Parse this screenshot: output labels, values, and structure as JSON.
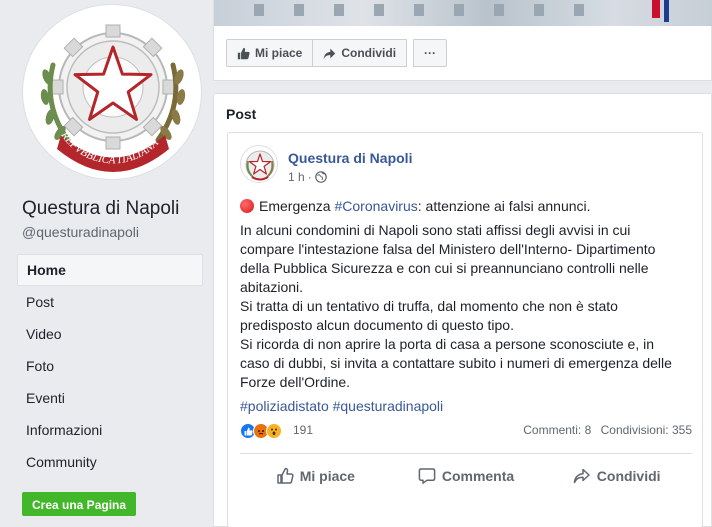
{
  "sidebar": {
    "page_name": "Questura di Napoli",
    "handle": "@questuradinapoli",
    "seal_text": "REPVBBLICA ITALIANA",
    "nav_items": [
      {
        "label": "Home",
        "active": true
      },
      {
        "label": "Post"
      },
      {
        "label": "Video"
      },
      {
        "label": "Foto"
      },
      {
        "label": "Eventi"
      },
      {
        "label": "Informazioni"
      },
      {
        "label": "Community"
      }
    ],
    "create_page_label": "Crea una Pagina"
  },
  "top_actions": {
    "like_label": "Mi piace",
    "share_label": "Condividi",
    "more_label": "···"
  },
  "posts_section": {
    "title": "Post",
    "post": {
      "author": "Questura di Napoli",
      "time": "1 h",
      "privacy_icon": "globe-icon",
      "headline_prefix": "Emergenza ",
      "headline_hashtag": "#Coronavirus",
      "headline_suffix": ": attenzione ai falsi annunci.",
      "body_lines": [
        "In alcuni condomini di Napoli sono stati affissi degli avvisi in cui",
        "compare l'intestazione falsa del Ministero dell'Interno- Dipartimento",
        "della Pubblica Sicurezza e con cui si preannunciano controlli nelle",
        "abitazioni.",
        "Si tratta di un tentativo di truffa, dal momento che non è stato",
        "predisposto alcun documento di questo tipo.",
        "Si ricorda di non aprire la porta di casa a persone sconosciute e, in",
        "caso di dubbi, si invita a contattare subito i numeri di emergenza delle",
        "Forze dell'Ordine."
      ],
      "hashtags": "#poliziadistato #questuradinapoli",
      "reaction_count": "191",
      "comments": "Commenti: 8",
      "shares": "Condivisioni: 355",
      "actions": {
        "like": "Mi piace",
        "comment": "Commenta",
        "share": "Condividi"
      }
    }
  },
  "colors": {
    "link_blue": "#385898",
    "create_green": "#42b72a",
    "background": "#e9ebee",
    "like_blue": "#1877f2"
  }
}
